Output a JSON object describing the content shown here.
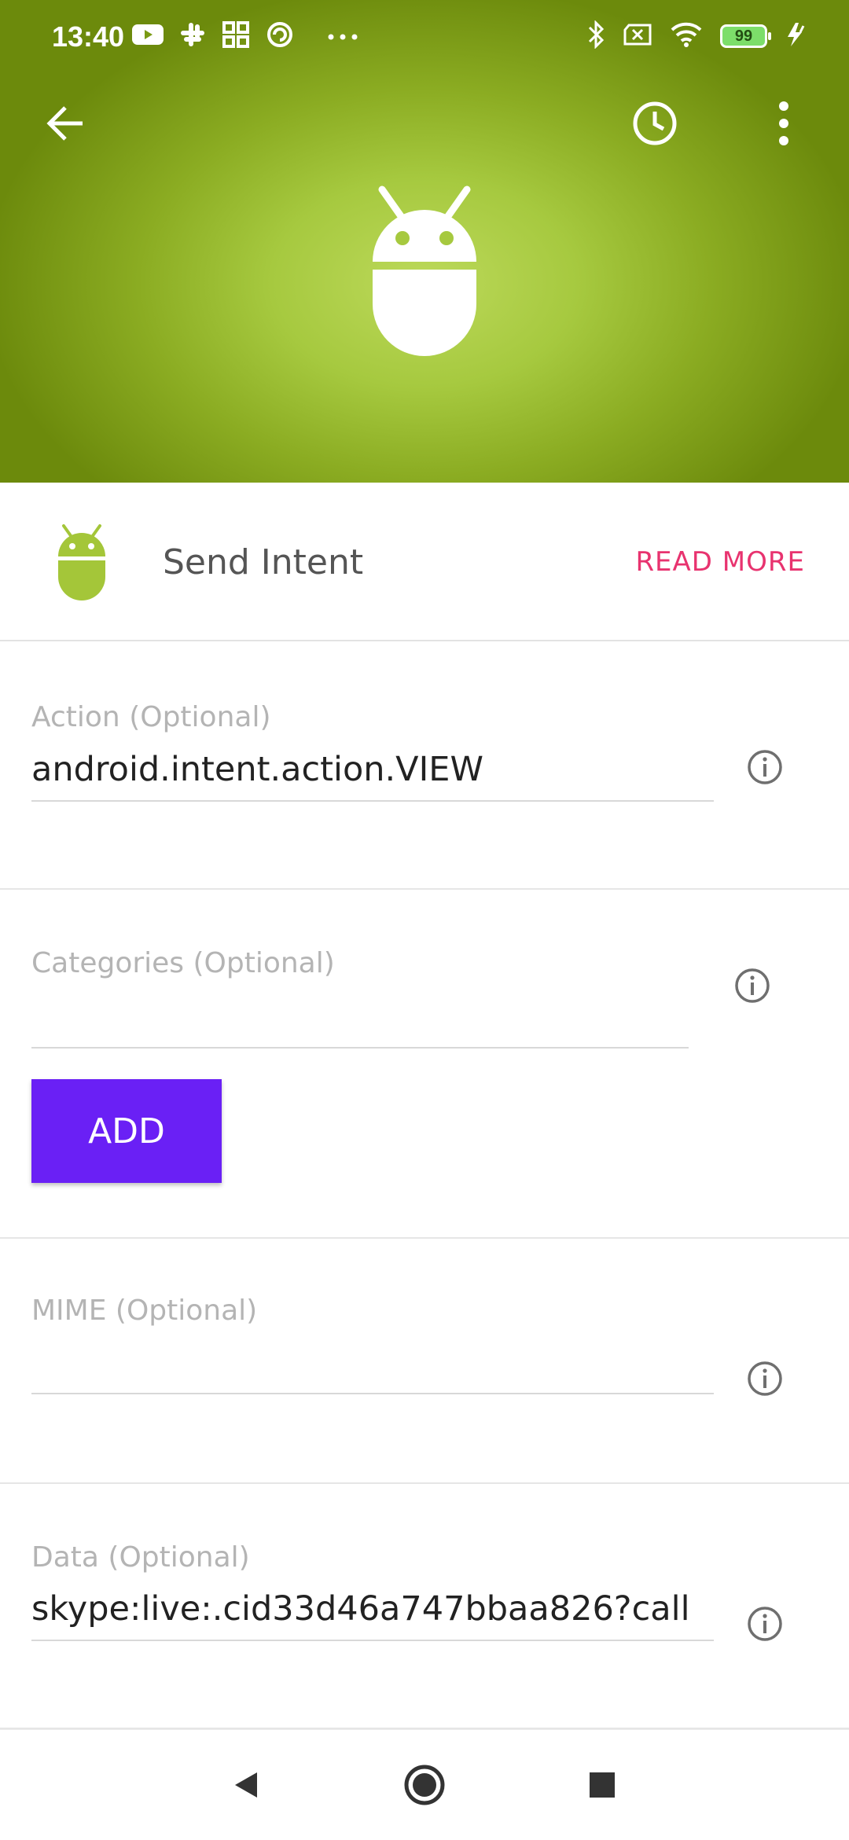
{
  "status_bar": {
    "time": "13:40",
    "battery": "99",
    "left_icons": [
      "youtube-icon",
      "slack-icon",
      "grid-apps-icon",
      "sync-icon",
      "more-dots-icon"
    ],
    "right_icons": [
      "bluetooth-icon",
      "no-sim-icon",
      "wifi-icon",
      "battery-icon",
      "charging-icon"
    ]
  },
  "app_bar": {
    "back_icon": "arrow-back-icon",
    "history_icon": "clock-icon",
    "menu_icon": "more-vert-icon"
  },
  "header": {
    "hero_icon": "android-robot-icon",
    "gradient_center": "#bcd95a",
    "gradient_edge": "#6c8a0c"
  },
  "action_info": {
    "title": "Send Intent",
    "read_more": "READ MORE",
    "read_more_color": "#e8336f"
  },
  "fields": {
    "action": {
      "label": "Action (Optional)",
      "value": "android.intent.action.VIEW"
    },
    "categories": {
      "label": "Categories (Optional)",
      "value": "",
      "add_button": "ADD"
    },
    "mime": {
      "label": "MIME (Optional)",
      "value": ""
    },
    "data": {
      "label": "Data (Optional)",
      "value": "skype:live:.cid33d46a747bbaa826?call"
    }
  },
  "colors": {
    "accent_purple": "#6a20f5",
    "android_green": "#a4c639"
  },
  "nav_bar": {
    "back_icon": "nav-back-icon",
    "home_icon": "nav-home-icon",
    "recents_icon": "nav-recents-icon"
  }
}
